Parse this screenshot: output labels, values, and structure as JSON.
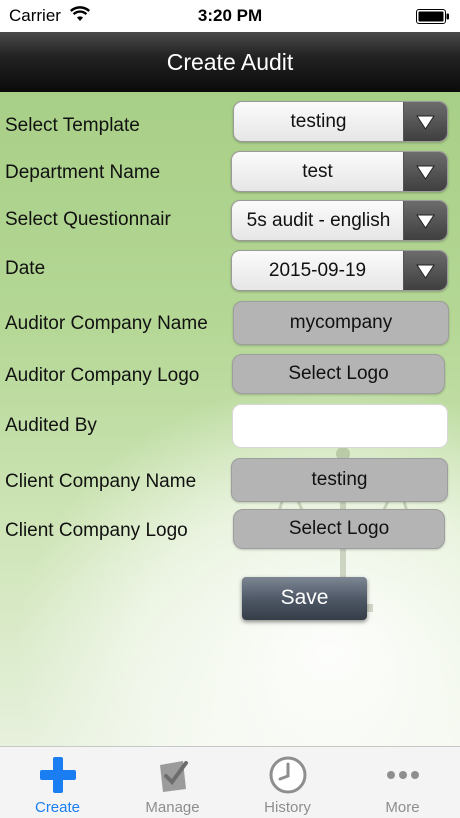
{
  "status_bar": {
    "carrier": "Carrier",
    "time": "3:20 PM"
  },
  "nav": {
    "title": "Create Audit"
  },
  "form": {
    "template_label": "Select Template",
    "template_value": "testing",
    "department_label": "Department Name",
    "department_value": "test",
    "questionnaire_label": "Select Questionnair",
    "questionnaire_value": "5s audit - english",
    "date_label": "Date",
    "date_value": "2015-09-19",
    "auditor_company_label": "Auditor Company Name",
    "auditor_company_value": "mycompany",
    "auditor_logo_label": "Auditor Company Logo",
    "auditor_logo_button": "Select Logo",
    "audited_by_label": "Audited By",
    "audited_by_value": "",
    "client_company_label": "Client Company Name",
    "client_company_value": "testing",
    "client_logo_label": "Client Company Logo",
    "client_logo_button": "Select Logo",
    "save_label": "Save"
  },
  "tab_bar": {
    "tabs": [
      {
        "label": "Create",
        "icon": "plus-icon",
        "active": true
      },
      {
        "label": "Manage",
        "icon": "clipboard-check-icon",
        "active": false
      },
      {
        "label": "History",
        "icon": "clock-icon",
        "active": false
      },
      {
        "label": "More",
        "icon": "more-dots-icon",
        "active": false
      }
    ]
  },
  "colors": {
    "accent": "#1a7ef2",
    "background_green": "#a8cf87",
    "nav_background": "#151515",
    "tab_inactive": "#8e8e8e"
  }
}
